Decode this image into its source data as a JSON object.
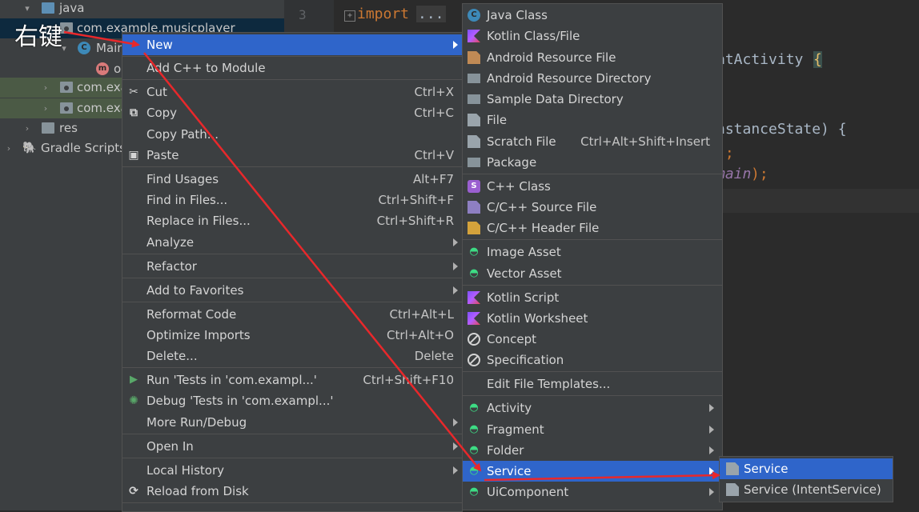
{
  "annotation": {
    "label": "右键",
    "arrow_color": "#e8282b"
  },
  "project_tree": {
    "rows": [
      {
        "label": "java",
        "arrow": "▾"
      },
      {
        "label": "com.example.musicplayer",
        "arrow": "▾"
      },
      {
        "label": "Main",
        "arrow": "▾",
        "badge": "C"
      },
      {
        "label": "o",
        "badge": "m"
      },
      {
        "label": "com.exa",
        "arrow": "›"
      },
      {
        "label": "com.exa",
        "arrow": "›"
      },
      {
        "label": "res",
        "arrow": "›"
      },
      {
        "label": "Gradle Scripts",
        "arrow": "›"
      }
    ]
  },
  "editor": {
    "line_number": "3",
    "fold_marker": "+",
    "import_keyword": "import",
    "import_fold": "...",
    "snippets": [
      "atActivity",
      "{",
      "nstanceState) {",
      ");",
      "main",
      ");"
    ]
  },
  "context_menu": {
    "items": [
      {
        "label": "New",
        "submenu": true
      },
      {
        "label": "Add C++ to Module"
      },
      {
        "label": "Cut",
        "shortcut": "Ctrl+X",
        "icon": "scissors-icon"
      },
      {
        "label": "Copy",
        "shortcut": "Ctrl+C",
        "icon": "copy-icon"
      },
      {
        "label": "Copy Path..."
      },
      {
        "label": "Paste",
        "shortcut": "Ctrl+V",
        "icon": "paste-icon"
      },
      {
        "label": "Find Usages",
        "shortcut": "Alt+F7"
      },
      {
        "label": "Find in Files...",
        "shortcut": "Ctrl+Shift+F"
      },
      {
        "label": "Replace in Files...",
        "shortcut": "Ctrl+Shift+R"
      },
      {
        "label": "Analyze",
        "submenu": true
      },
      {
        "label": "Refactor",
        "submenu": true
      },
      {
        "label": "Add to Favorites",
        "submenu": true
      },
      {
        "label": "Reformat Code",
        "shortcut": "Ctrl+Alt+L"
      },
      {
        "label": "Optimize Imports",
        "shortcut": "Ctrl+Alt+O"
      },
      {
        "label": "Delete...",
        "shortcut": "Delete"
      },
      {
        "label": "Run 'Tests in 'com.exampl...'",
        "shortcut": "Ctrl+Shift+F10",
        "icon": "run-icon"
      },
      {
        "label": "Debug 'Tests in 'com.exampl...'",
        "icon": "debug-icon"
      },
      {
        "label": "More Run/Debug",
        "submenu": true
      },
      {
        "label": "Open In",
        "submenu": true
      },
      {
        "label": "Local History",
        "submenu": true
      },
      {
        "label": "Reload from Disk",
        "icon": "reload-icon"
      }
    ]
  },
  "new_submenu": {
    "items": [
      {
        "label": "Java Class",
        "icon": "java-class-icon"
      },
      {
        "label": "Kotlin Class/File",
        "icon": "kotlin-icon"
      },
      {
        "label": "Android Resource File",
        "icon": "resource-file-icon"
      },
      {
        "label": "Android Resource Directory",
        "icon": "folder-icon"
      },
      {
        "label": "Sample Data Directory",
        "icon": "folder-icon"
      },
      {
        "label": "File",
        "icon": "file-icon"
      },
      {
        "label": "Scratch File",
        "shortcut": "Ctrl+Alt+Shift+Insert",
        "icon": "scratch-file-icon"
      },
      {
        "label": "Package",
        "icon": "package-icon"
      },
      {
        "label": "C++ Class",
        "icon": "cpp-class-icon"
      },
      {
        "label": "C/C++ Source File",
        "icon": "cpp-source-icon"
      },
      {
        "label": "C/C++ Header File",
        "icon": "cpp-header-icon"
      },
      {
        "label": "Image Asset",
        "icon": "android-icon"
      },
      {
        "label": "Vector Asset",
        "icon": "android-icon"
      },
      {
        "label": "Kotlin Script",
        "icon": "kotlin-icon"
      },
      {
        "label": "Kotlin Worksheet",
        "icon": "kotlin-icon"
      },
      {
        "label": "Concept",
        "icon": "mps-icon"
      },
      {
        "label": "Specification",
        "icon": "mps-icon"
      },
      {
        "label": "Edit File Templates..."
      },
      {
        "label": "Activity",
        "submenu": true,
        "icon": "android-icon"
      },
      {
        "label": "Fragment",
        "submenu": true,
        "icon": "android-icon"
      },
      {
        "label": "Folder",
        "submenu": true,
        "icon": "android-icon"
      },
      {
        "label": "Service",
        "submenu": true,
        "icon": "android-icon"
      },
      {
        "label": "UiComponent",
        "submenu": true,
        "icon": "android-icon"
      }
    ]
  },
  "service_submenu": {
    "items": [
      {
        "label": "Service",
        "icon": "android-file-icon"
      },
      {
        "label": "Service (IntentService)",
        "icon": "android-file-icon"
      }
    ]
  }
}
